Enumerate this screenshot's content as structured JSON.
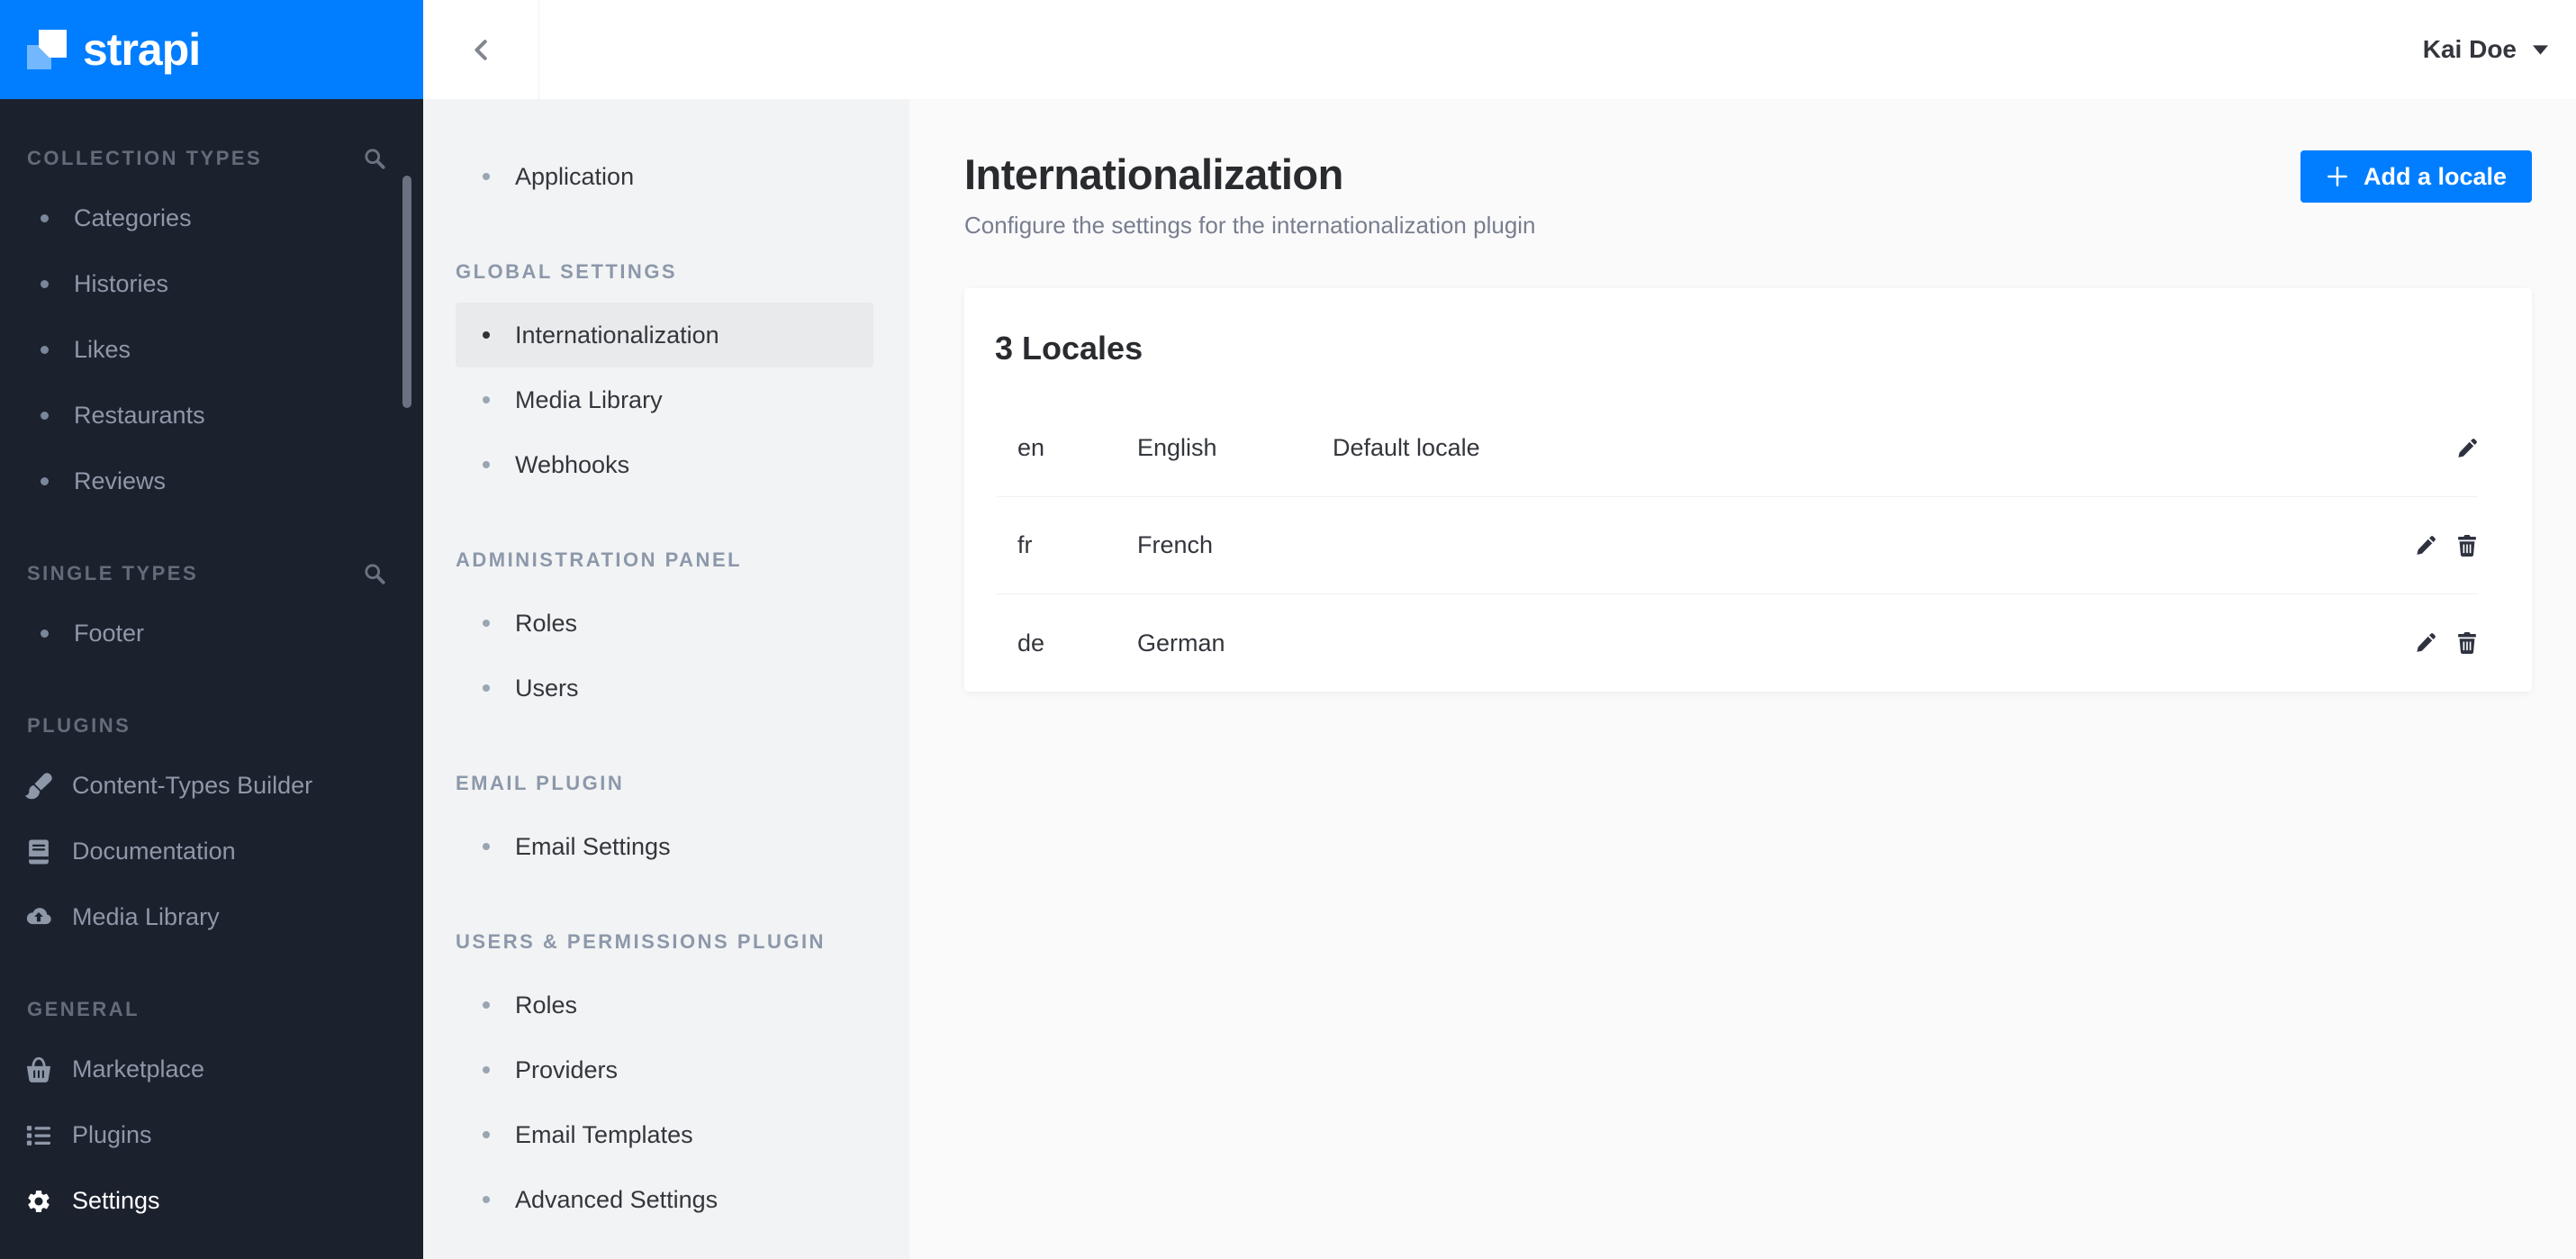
{
  "brand": {
    "name": "strapi"
  },
  "topbar": {
    "user_name": "Kai Doe"
  },
  "sidebar": {
    "sections": [
      {
        "label": "COLLECTION TYPES",
        "search": true,
        "items": [
          {
            "label": "Categories"
          },
          {
            "label": "Histories"
          },
          {
            "label": "Likes"
          },
          {
            "label": "Restaurants"
          },
          {
            "label": "Reviews"
          }
        ]
      },
      {
        "label": "SINGLE TYPES",
        "search": true,
        "items": [
          {
            "label": "Footer"
          }
        ]
      },
      {
        "label": "PLUGINS",
        "search": false,
        "items": [
          {
            "label": "Content-Types Builder",
            "icon": "paintbrush-icon"
          },
          {
            "label": "Documentation",
            "icon": "book-icon"
          },
          {
            "label": "Media Library",
            "icon": "cloud-upload-icon"
          }
        ]
      },
      {
        "label": "GENERAL",
        "search": false,
        "items": [
          {
            "label": "Marketplace",
            "icon": "basket-icon"
          },
          {
            "label": "Plugins",
            "icon": "list-icon"
          },
          {
            "label": "Settings",
            "icon": "gear-icon",
            "active": true
          }
        ]
      }
    ]
  },
  "settings_nav": {
    "groups": [
      {
        "label": "",
        "items": [
          {
            "label": "Application"
          }
        ]
      },
      {
        "label": "GLOBAL SETTINGS",
        "items": [
          {
            "label": "Internationalization",
            "active": true
          },
          {
            "label": "Media Library"
          },
          {
            "label": "Webhooks"
          }
        ]
      },
      {
        "label": "ADMINISTRATION PANEL",
        "items": [
          {
            "label": "Roles"
          },
          {
            "label": "Users"
          }
        ]
      },
      {
        "label": "EMAIL PLUGIN",
        "items": [
          {
            "label": "Email Settings"
          }
        ]
      },
      {
        "label": "USERS & PERMISSIONS PLUGIN",
        "items": [
          {
            "label": "Roles"
          },
          {
            "label": "Providers"
          },
          {
            "label": "Email Templates"
          },
          {
            "label": "Advanced Settings"
          }
        ]
      }
    ]
  },
  "page": {
    "title": "Internationalization",
    "subtitle": "Configure the settings for the internationalization plugin",
    "add_locale_button": "Add a locale"
  },
  "locales_card": {
    "title": "3 Locales",
    "rows": [
      {
        "code": "en",
        "name": "English",
        "tag": "Default locale",
        "actions": [
          "edit"
        ]
      },
      {
        "code": "fr",
        "name": "French",
        "tag": "",
        "actions": [
          "edit",
          "delete"
        ]
      },
      {
        "code": "de",
        "name": "German",
        "tag": "",
        "actions": [
          "edit",
          "delete"
        ]
      }
    ]
  },
  "colors": {
    "brand_blue": "#007eff",
    "sidebar_bg": "#1c212e",
    "subnav_bg": "#f2f3f4",
    "subnav_active_bg": "#e9eaeb",
    "main_bg": "#fafafb"
  }
}
